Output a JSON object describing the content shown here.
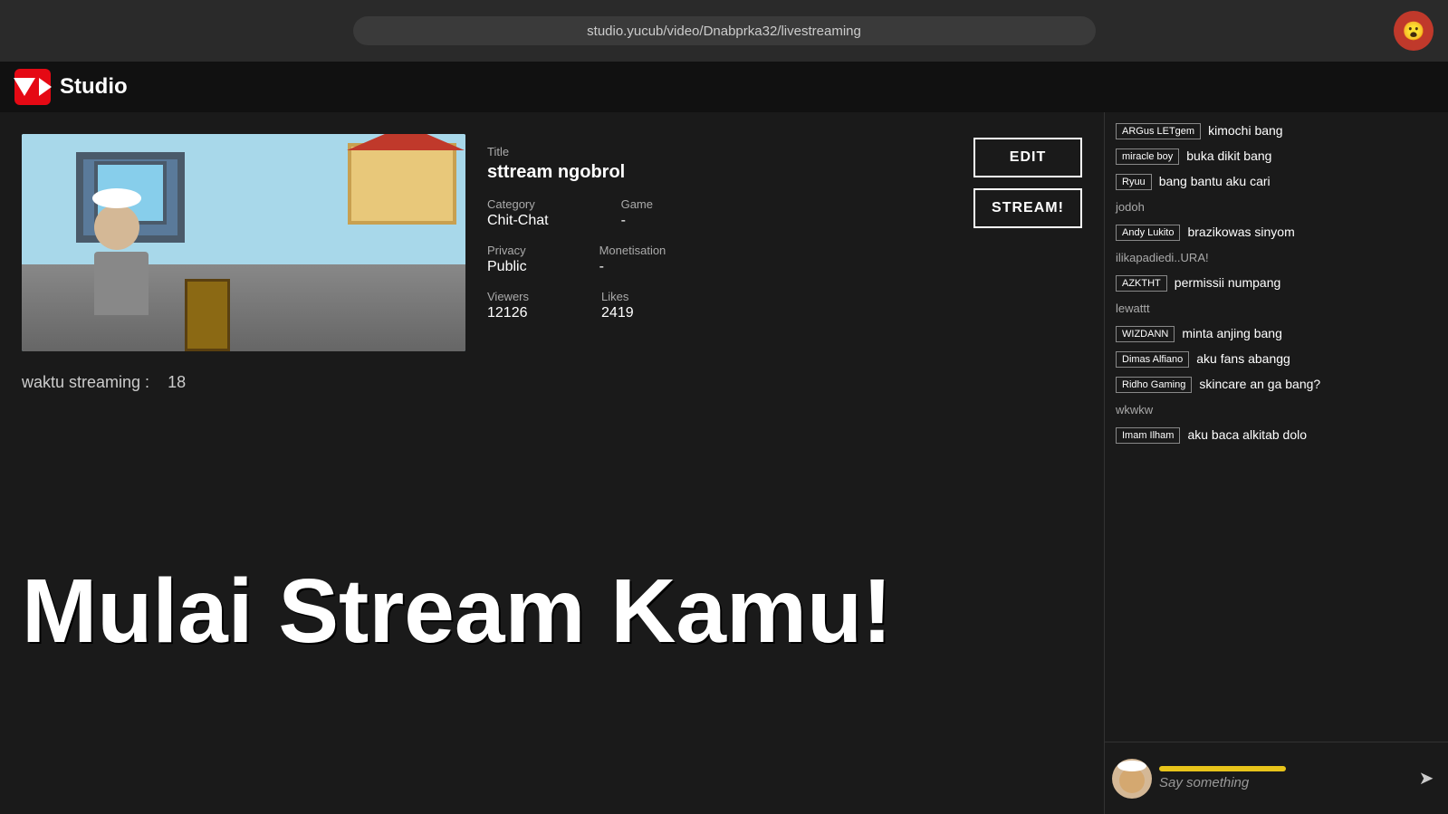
{
  "browser": {
    "url": "studio.yucub/video/Dnabprka32/livestreaming"
  },
  "nav": {
    "logo_text": "Studio"
  },
  "stream": {
    "title_label": "Title",
    "title_value": "sttream ngobrol",
    "category_label": "Category",
    "category_value": "Chit-Chat",
    "game_label": "Game",
    "game_value": "-",
    "privacy_label": "Privacy",
    "privacy_value": "Public",
    "monetisation_label": "Monetisation",
    "monetisation_value": "-",
    "viewers_label": "Viewers",
    "viewers_value": "12126",
    "likes_label": "Likes",
    "likes_value": "2419",
    "edit_btn": "EDIT",
    "stream_btn": "STREAM!",
    "streaming_time_label": "waktu streaming :",
    "streaming_time_value": "18",
    "headline": "Mulai Stream Kamu!"
  },
  "chat": {
    "messages": [
      {
        "badge": "ARGus LETgem",
        "plain_user": "",
        "text": "kimochi bang"
      },
      {
        "badge": "miracle boy",
        "plain_user": "",
        "text": "buka dikit bang"
      },
      {
        "badge": "Ryuu",
        "plain_user": "",
        "text": "bang bantu aku cari"
      },
      {
        "badge": "",
        "plain_user": "jodoh",
        "text": ""
      },
      {
        "badge": "Andy Lukito",
        "plain_user": "",
        "text": "brazikowas sinyom"
      },
      {
        "badge": "",
        "plain_user": "ilikapadiedi..URA!",
        "text": ""
      },
      {
        "badge": "AZKTHT",
        "plain_user": "",
        "text": "permissii numpang"
      },
      {
        "badge": "",
        "plain_user": "lewattt",
        "text": ""
      },
      {
        "badge": "WIZDANN",
        "plain_user": "",
        "text": "minta anjing bang"
      },
      {
        "badge": "Dimas Alfiano",
        "plain_user": "",
        "text": "aku fans abangg"
      },
      {
        "badge": "Ridho Gaming",
        "plain_user": "",
        "text": "skincare an ga bang?"
      },
      {
        "badge": "",
        "plain_user": "wkwkw",
        "text": ""
      },
      {
        "badge": "Imam Ilham",
        "plain_user": "",
        "text": "aku baca alkitab dolo"
      }
    ],
    "input_placeholder": "Say something",
    "send_icon": "➤"
  }
}
